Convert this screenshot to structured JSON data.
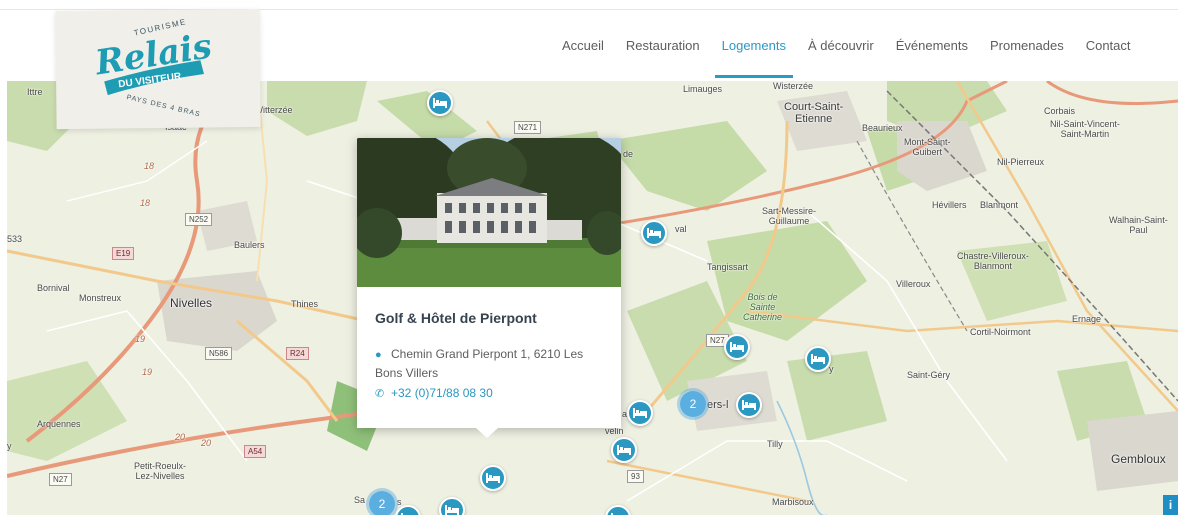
{
  "logo": {
    "top_text": "TOURISME",
    "main_text": "Relais",
    "ribbon_text": "DU VISITEUR",
    "bottom_text": "PAYS DES 4 BRAS",
    "colors": {
      "teal": "#1e9cb3",
      "dark": "#3c5866"
    }
  },
  "nav": {
    "items": [
      {
        "label": "Accueil"
      },
      {
        "label": "Restauration"
      },
      {
        "label": "Logements"
      },
      {
        "label": "À découvrir"
      },
      {
        "label": "Événements"
      },
      {
        "label": "Promenades"
      },
      {
        "label": "Contact"
      }
    ],
    "active": "Logements"
  },
  "popup": {
    "title": "Golf & Hôtel de Pierpont",
    "address": "Chemin Grand Pierpont 1, 6210 Les Bons Villers",
    "phone": "+32 (0)71/88 08 30",
    "address_icon": "map-marker-icon",
    "phone_icon": "phone-icon"
  },
  "map": {
    "places": {
      "ittre": "Ittre",
      "lillois": "Lillois-Witterzée",
      "isaac": "Isaac",
      "baulers": "Baulers",
      "bornival": "Bornival",
      "monstreux": "Monstreux",
      "nivelles": "Nivelles",
      "thines": "Thines",
      "arquennes": "Arquennes",
      "petit_roeulx": "Petit-Roeulx-\nLez-Nivelles",
      "limauges": "Limauges",
      "wisterzee": "Wisterzée",
      "court_st_etienne": "Court-Saint-\nEtienne",
      "beaurieux": "Beaurieux",
      "mont_st_guibert": "Mont-Saint-\nGuibert",
      "corbais": "Corbais",
      "nil_st_vincent": "Nil-Saint-Vincent-\nSaint-Martin",
      "nil_pierreux": "Nil-Pierreux",
      "sart_messire": "Sart-Messire-\nGuillaume",
      "hevillers": "Hévillers",
      "blanmont": "Blanmont",
      "walhain": "Walhain-Saint-\nPaul",
      "chastre": "Chastre-Villeroux-\nBlanmont",
      "tangissart": "Tangissart",
      "villeroux": "Villeroux",
      "bois_ste_catherine": "Bois de\nSainte\nCatherine",
      "cortil": "Cortil-Noirmont",
      "ernage": "Ernage",
      "saint_gery": "Saint-Géry",
      "tilly": "Tilly",
      "marbisoux": "Marbisoux",
      "gembloux": "Gembloux",
      "val": "val",
      "ers_l": "ers-l",
      "velin": "velin",
      "y_frag": "y",
      "sa_frag": "Sa",
      "s_frag": "s",
      "de_frag": "de",
      "da_frag": "a"
    },
    "roads": {
      "n271": "N271",
      "n252": "N252",
      "e19": "E19",
      "n586": "N586",
      "r24": "R24",
      "a54": "A54",
      "n27_left": "N27",
      "n27_mid": "N27",
      "n93": "93",
      "r533": "533",
      "n18a": "18",
      "n18b": "18",
      "n19a": "19",
      "n19b": "19",
      "n20a": "20",
      "n20b": "20",
      "y_left": "y"
    },
    "clusters": [
      "2",
      "2"
    ],
    "info_label": "i",
    "pin_icon": "bed-icon",
    "colors": {
      "marker": "#2b98c2",
      "cluster": "#5aaee0",
      "forest": "#c5dba8",
      "urban": "#d9d6d0",
      "major_road": "#e8997a",
      "secondary_road": "#f3c98b",
      "water": "#9cc8e0"
    }
  }
}
